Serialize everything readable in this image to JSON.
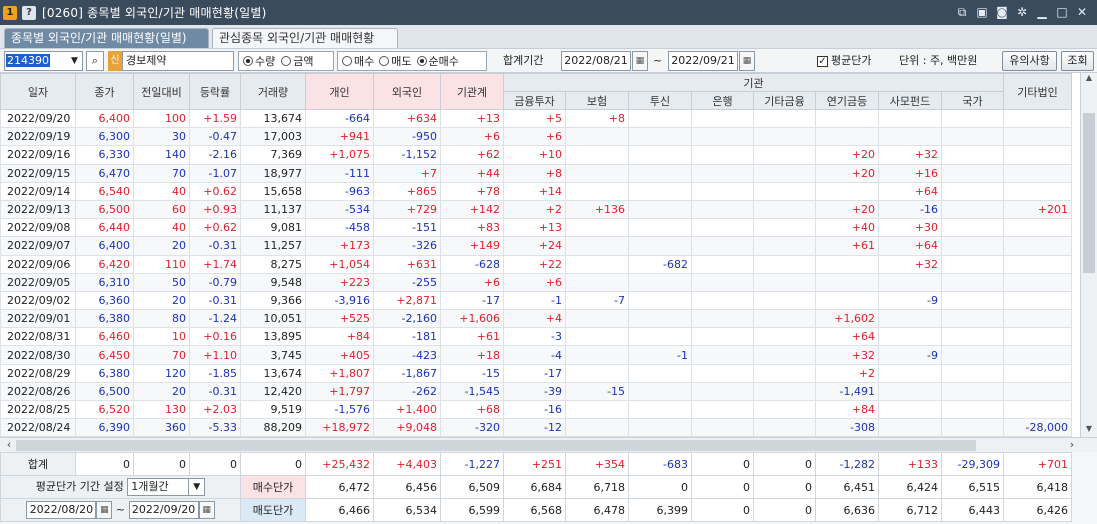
{
  "window": {
    "badge_num": "1",
    "badge_q": "?",
    "title": "[0260] 종목별 외국인/기관 매매현황(일별)",
    "icons": [
      "link-icon",
      "save-icon",
      "screenshot-icon",
      "settings-icon",
      "minimize-icon",
      "maximize-icon",
      "close-icon"
    ]
  },
  "tabs": [
    {
      "label": "종목별 외국인/기관 매매현황(일별)",
      "active": true
    },
    {
      "label": "관심종목 외국인/기관 매매현황",
      "active": false
    }
  ],
  "controls": {
    "stock_code": "214390",
    "shin_badge": "신",
    "stock_name": "경보제약",
    "radio_unit": [
      {
        "label": "수량",
        "checked": true
      },
      {
        "label": "금액",
        "checked": false
      }
    ],
    "radio_trade": [
      {
        "label": "매수",
        "checked": false
      },
      {
        "label": "매도",
        "checked": false
      },
      {
        "label": "순매수",
        "checked": true
      }
    ],
    "period_label": "합계기간",
    "date_from": "2022/08/21",
    "date_to": "2022/09/21",
    "tilde": "~",
    "avg_price_checkbox": "평균단가",
    "avg_price_checked": true,
    "unit_label": "단위 : 주, 백만원",
    "notice_button": "유의사항",
    "query_button": "조회"
  },
  "table": {
    "group_header": "기관",
    "columns": [
      "일자",
      "종가",
      "전일대비",
      "등락률",
      "거래량",
      "개인",
      "외국인",
      "기관계",
      "금융투자",
      "보험",
      "투신",
      "은행",
      "기타금융",
      "연기금등",
      "사모펀드",
      "국가",
      "기타법인"
    ],
    "rows": [
      [
        "2022/09/20",
        "6,400",
        "100",
        "+1.59",
        "13,674",
        "-664",
        "+634",
        "+13",
        "+5",
        "+8",
        "",
        "",
        "",
        "",
        "",
        "",
        ""
      ],
      [
        "2022/09/19",
        "6,300",
        "30",
        "-0.47",
        "17,003",
        "+941",
        "-950",
        "+6",
        "+6",
        "",
        "",
        "",
        "",
        "",
        "",
        "",
        ""
      ],
      [
        "2022/09/16",
        "6,330",
        "140",
        "-2.16",
        "7,369",
        "+1,075",
        "-1,152",
        "+62",
        "+10",
        "",
        "",
        "",
        "",
        "+20",
        "+32",
        "",
        ""
      ],
      [
        "2022/09/15",
        "6,470",
        "70",
        "-1.07",
        "18,977",
        "-111",
        "+7",
        "+44",
        "+8",
        "",
        "",
        "",
        "",
        "+20",
        "+16",
        "",
        ""
      ],
      [
        "2022/09/14",
        "6,540",
        "40",
        "+0.62",
        "15,658",
        "-963",
        "+865",
        "+78",
        "+14",
        "",
        "",
        "",
        "",
        "",
        "+64",
        "",
        ""
      ],
      [
        "2022/09/13",
        "6,500",
        "60",
        "+0.93",
        "11,137",
        "-534",
        "+729",
        "+142",
        "+2",
        "+136",
        "",
        "",
        "",
        "+20",
        "-16",
        "",
        "+201"
      ],
      [
        "2022/09/08",
        "6,440",
        "40",
        "+0.62",
        "9,081",
        "-458",
        "-151",
        "+83",
        "+13",
        "",
        "",
        "",
        "",
        "+40",
        "+30",
        "",
        ""
      ],
      [
        "2022/09/07",
        "6,400",
        "20",
        "-0.31",
        "11,257",
        "+173",
        "-326",
        "+149",
        "+24",
        "",
        "",
        "",
        "",
        "+61",
        "+64",
        "",
        ""
      ],
      [
        "2022/09/06",
        "6,420",
        "110",
        "+1.74",
        "8,275",
        "+1,054",
        "+631",
        "-628",
        "+22",
        "",
        "-682",
        "",
        "",
        "",
        "+32",
        "",
        ""
      ],
      [
        "2022/09/05",
        "6,310",
        "50",
        "-0.79",
        "9,548",
        "+223",
        "-255",
        "+6",
        "+6",
        "",
        "",
        "",
        "",
        "",
        "",
        "",
        ""
      ],
      [
        "2022/09/02",
        "6,360",
        "20",
        "-0.31",
        "9,366",
        "-3,916",
        "+2,871",
        "-17",
        "-1",
        "-7",
        "",
        "",
        "",
        "",
        "-9",
        "",
        ""
      ],
      [
        "2022/09/01",
        "6,380",
        "80",
        "-1.24",
        "10,051",
        "+525",
        "-2,160",
        "+1,606",
        "+4",
        "",
        "",
        "",
        "",
        "+1,602",
        "",
        "",
        ""
      ],
      [
        "2022/08/31",
        "6,460",
        "10",
        "+0.16",
        "13,895",
        "+84",
        "-181",
        "+61",
        "-3",
        "",
        "",
        "",
        "",
        "+64",
        "",
        "",
        ""
      ],
      [
        "2022/08/30",
        "6,450",
        "70",
        "+1.10",
        "3,745",
        "+405",
        "-423",
        "+18",
        "-4",
        "",
        "-1",
        "",
        "",
        "+32",
        "-9",
        "",
        ""
      ],
      [
        "2022/08/29",
        "6,380",
        "120",
        "-1.85",
        "13,674",
        "+1,807",
        "-1,867",
        "-15",
        "-17",
        "",
        "",
        "",
        "",
        "+2",
        "",
        "",
        ""
      ],
      [
        "2022/08/26",
        "6,500",
        "20",
        "-0.31",
        "12,420",
        "+1,797",
        "-262",
        "-1,545",
        "-39",
        "-15",
        "",
        "",
        "",
        "-1,491",
        "",
        "",
        ""
      ],
      [
        "2022/08/25",
        "6,520",
        "130",
        "+2.03",
        "9,519",
        "-1,576",
        "+1,400",
        "+68",
        "-16",
        "",
        "",
        "",
        "",
        "+84",
        "",
        "",
        ""
      ],
      [
        "2022/08/24",
        "6,390",
        "360",
        "-5.33",
        "88,209",
        "+18,972",
        "+9,048",
        "-320",
        "-12",
        "",
        "",
        "",
        "",
        "-308",
        "",
        "",
        "-28,000"
      ]
    ]
  },
  "totals": {
    "label": "합계",
    "values": [
      "0",
      "0",
      "0",
      "0",
      "+25,432",
      "+4,403",
      "-1,227",
      "+251",
      "+354",
      "-683",
      "0",
      "0",
      "-1,282",
      "+133",
      "-29,309",
      "+701"
    ],
    "avg_setting_label": "평균단가 기간 설정",
    "avg_period": "1개월간",
    "avg_date_from": "2022/08/20",
    "avg_date_to": "2022/09/20",
    "tilde": "~",
    "buy_label": "매수단가",
    "buy_values": [
      "6,472",
      "6,456",
      "6,509",
      "6,684",
      "6,718",
      "0",
      "0",
      "0",
      "6,451",
      "6,424",
      "6,515",
      "6,418"
    ],
    "sell_label": "매도단가",
    "sell_values": [
      "6,466",
      "6,534",
      "6,599",
      "6,568",
      "6,478",
      "6,399",
      "0",
      "0",
      "6,636",
      "6,712",
      "6,443",
      "6,426"
    ]
  },
  "colors": {
    "up": "#e0202a",
    "down": "#1a32b8",
    "titlebar": "#3b4b5e",
    "active_tab": "#6e8aa5"
  }
}
